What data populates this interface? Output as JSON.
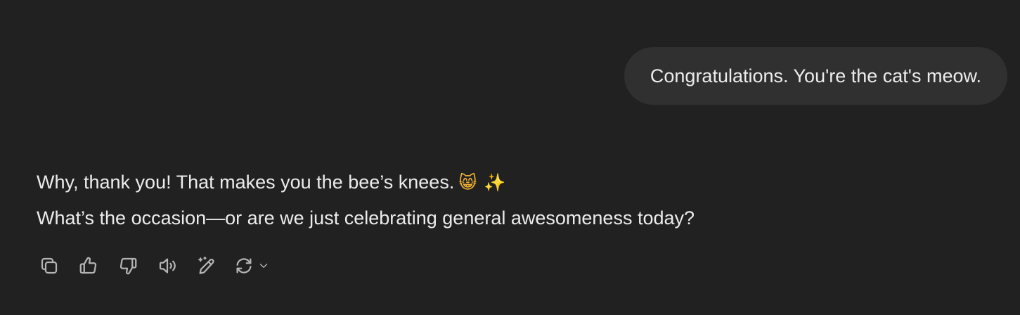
{
  "user_message": {
    "text": "Congratulations. You're the cat's meow."
  },
  "assistant_message": {
    "line1": "Why, thank you! That makes you the bee’s knees.",
    "emoji1": "😸",
    "emoji2": "✨",
    "line2": "What’s the occasion—or are we just celebrating general awesomeness today?"
  },
  "actions": [
    {
      "icon": "copy-icon"
    },
    {
      "icon": "thumbs-up-icon"
    },
    {
      "icon": "thumbs-down-icon"
    },
    {
      "icon": "read-aloud-icon"
    },
    {
      "icon": "edit-in-canvas-icon"
    },
    {
      "icon": "regenerate-icon"
    }
  ],
  "colors": {
    "background": "#212121",
    "bubble": "#303030",
    "text": "#ececec",
    "icon": "#b4b4b4"
  }
}
